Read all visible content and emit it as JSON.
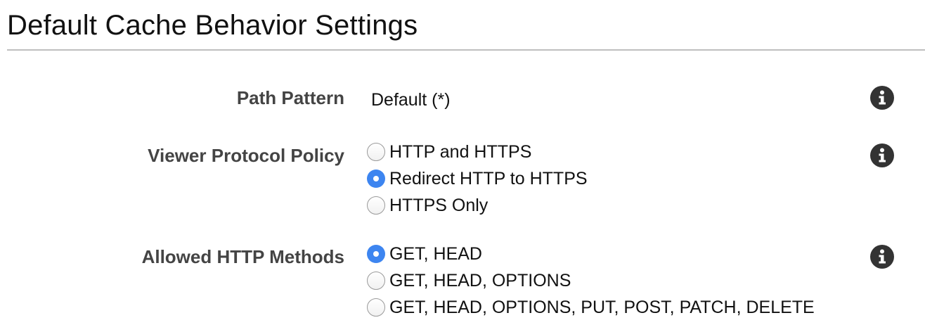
{
  "section": {
    "title": "Default Cache Behavior Settings"
  },
  "fields": {
    "path_pattern": {
      "label": "Path Pattern",
      "value": "Default (*)"
    },
    "viewer_protocol_policy": {
      "label": "Viewer Protocol Policy",
      "options": [
        {
          "label": "HTTP and HTTPS",
          "selected": false
        },
        {
          "label": "Redirect HTTP to HTTPS",
          "selected": true
        },
        {
          "label": "HTTPS Only",
          "selected": false
        }
      ]
    },
    "allowed_http_methods": {
      "label": "Allowed HTTP Methods",
      "options": [
        {
          "label": "GET, HEAD",
          "selected": true
        },
        {
          "label": "GET, HEAD, OPTIONS",
          "selected": false
        },
        {
          "label": "GET, HEAD, OPTIONS, PUT, POST, PATCH, DELETE",
          "selected": false
        }
      ]
    }
  },
  "icons": {
    "info": "info-icon"
  },
  "colors": {
    "radio_selected": "#3d85f0",
    "label_text": "#444444",
    "divider": "#bfbfbf",
    "info_icon": "#333333"
  }
}
